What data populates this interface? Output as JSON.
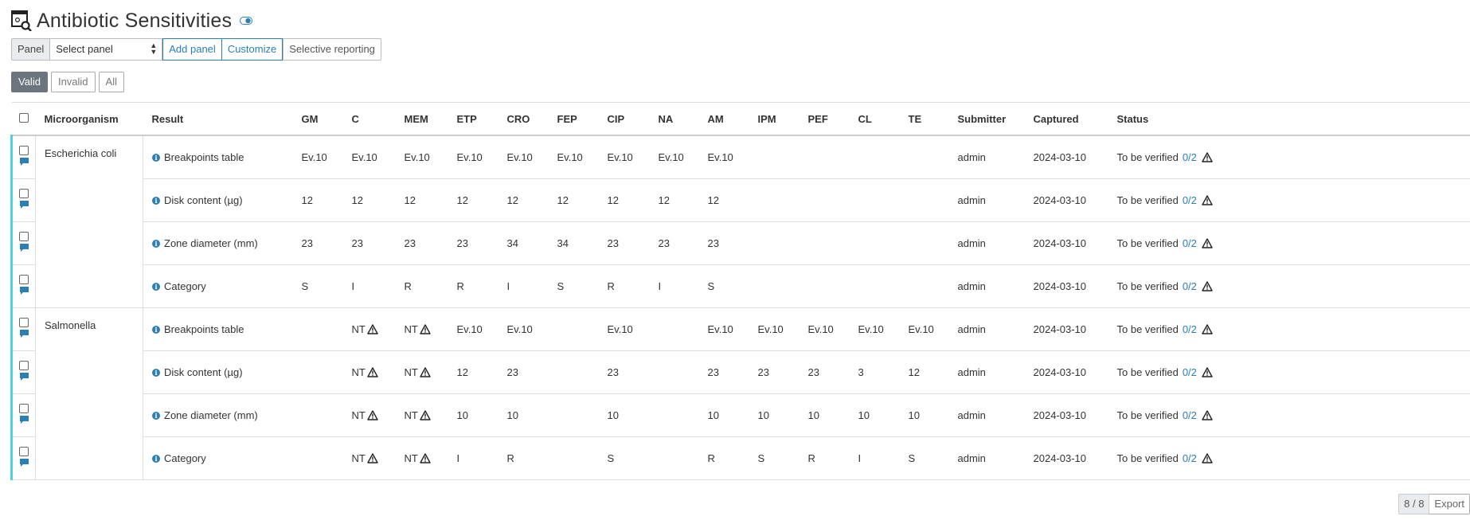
{
  "page": {
    "title": "Antibiotic Sensitivities"
  },
  "toolbar": {
    "panel_label": "Panel",
    "panel_select_value": "Select panel",
    "add_panel": "Add panel",
    "customize": "Customize",
    "selective_reporting": "Selective reporting"
  },
  "filters": {
    "valid": "Valid",
    "invalid": "Invalid",
    "all": "All"
  },
  "columns": [
    "Microorganism",
    "Result",
    "GM",
    "C",
    "MEM",
    "ETP",
    "CRO",
    "FEP",
    "CIP",
    "NA",
    "AM",
    "IPM",
    "PEF",
    "CL",
    "TE",
    "Submitter",
    "Captured",
    "Status"
  ],
  "groups": [
    {
      "organism": "Escherichia coli",
      "rows": [
        {
          "result": "Breakpoints table",
          "values": [
            "Ev.10",
            "Ev.10",
            "Ev.10",
            "Ev.10",
            "Ev.10",
            "Ev.10",
            "Ev.10",
            "Ev.10",
            "Ev.10",
            "",
            "",
            "",
            ""
          ],
          "submitter": "admin",
          "captured": "2024-03-10",
          "status": "To be verified",
          "verif": "0/2"
        },
        {
          "result": "Disk content (µg)",
          "values": [
            "12",
            "12",
            "12",
            "12",
            "12",
            "12",
            "12",
            "12",
            "12",
            "",
            "",
            "",
            ""
          ],
          "submitter": "admin",
          "captured": "2024-03-10",
          "status": "To be verified",
          "verif": "0/2"
        },
        {
          "result": "Zone diameter (mm)",
          "values": [
            "23",
            "23",
            "23",
            "23",
            "34",
            "34",
            "23",
            "23",
            "23",
            "",
            "",
            "",
            ""
          ],
          "submitter": "admin",
          "captured": "2024-03-10",
          "status": "To be verified",
          "verif": "0/2"
        },
        {
          "result": "Category",
          "values": [
            "S",
            "I",
            "R",
            "R",
            "I",
            "S",
            "R",
            "I",
            "S",
            "",
            "",
            "",
            ""
          ],
          "submitter": "admin",
          "captured": "2024-03-10",
          "status": "To be verified",
          "verif": "0/2"
        }
      ]
    },
    {
      "organism": "Salmonella",
      "rows": [
        {
          "result": "Breakpoints table",
          "values": [
            "",
            "NT",
            "NT",
            "Ev.10",
            "Ev.10",
            "",
            "Ev.10",
            "",
            "Ev.10",
            "Ev.10",
            "Ev.10",
            "Ev.10",
            "Ev.10"
          ],
          "submitter": "admin",
          "captured": "2024-03-10",
          "status": "To be verified",
          "verif": "0/2"
        },
        {
          "result": "Disk content (µg)",
          "values": [
            "",
            "NT",
            "NT",
            "12",
            "23",
            "",
            "23",
            "",
            "23",
            "23",
            "23",
            "3",
            "12"
          ],
          "submitter": "admin",
          "captured": "2024-03-10",
          "status": "To be verified",
          "verif": "0/2"
        },
        {
          "result": "Zone diameter (mm)",
          "values": [
            "",
            "NT",
            "NT",
            "10",
            "10",
            "",
            "10",
            "",
            "10",
            "10",
            "10",
            "10",
            "10"
          ],
          "submitter": "admin",
          "captured": "2024-03-10",
          "status": "To be verified",
          "verif": "0/2"
        },
        {
          "result": "Category",
          "values": [
            "",
            "NT",
            "NT",
            "I",
            "R",
            "",
            "S",
            "",
            "R",
            "S",
            "R",
            "I",
            "S"
          ],
          "submitter": "admin",
          "captured": "2024-03-10",
          "status": "To be verified",
          "verif": "0/2"
        }
      ]
    }
  ],
  "footer": {
    "count": "8 / 8",
    "export": "Export"
  },
  "colors": {
    "accent": "#2a7fb6",
    "row_marker": "#4fd1e0",
    "active_filter": "#6c757d"
  }
}
